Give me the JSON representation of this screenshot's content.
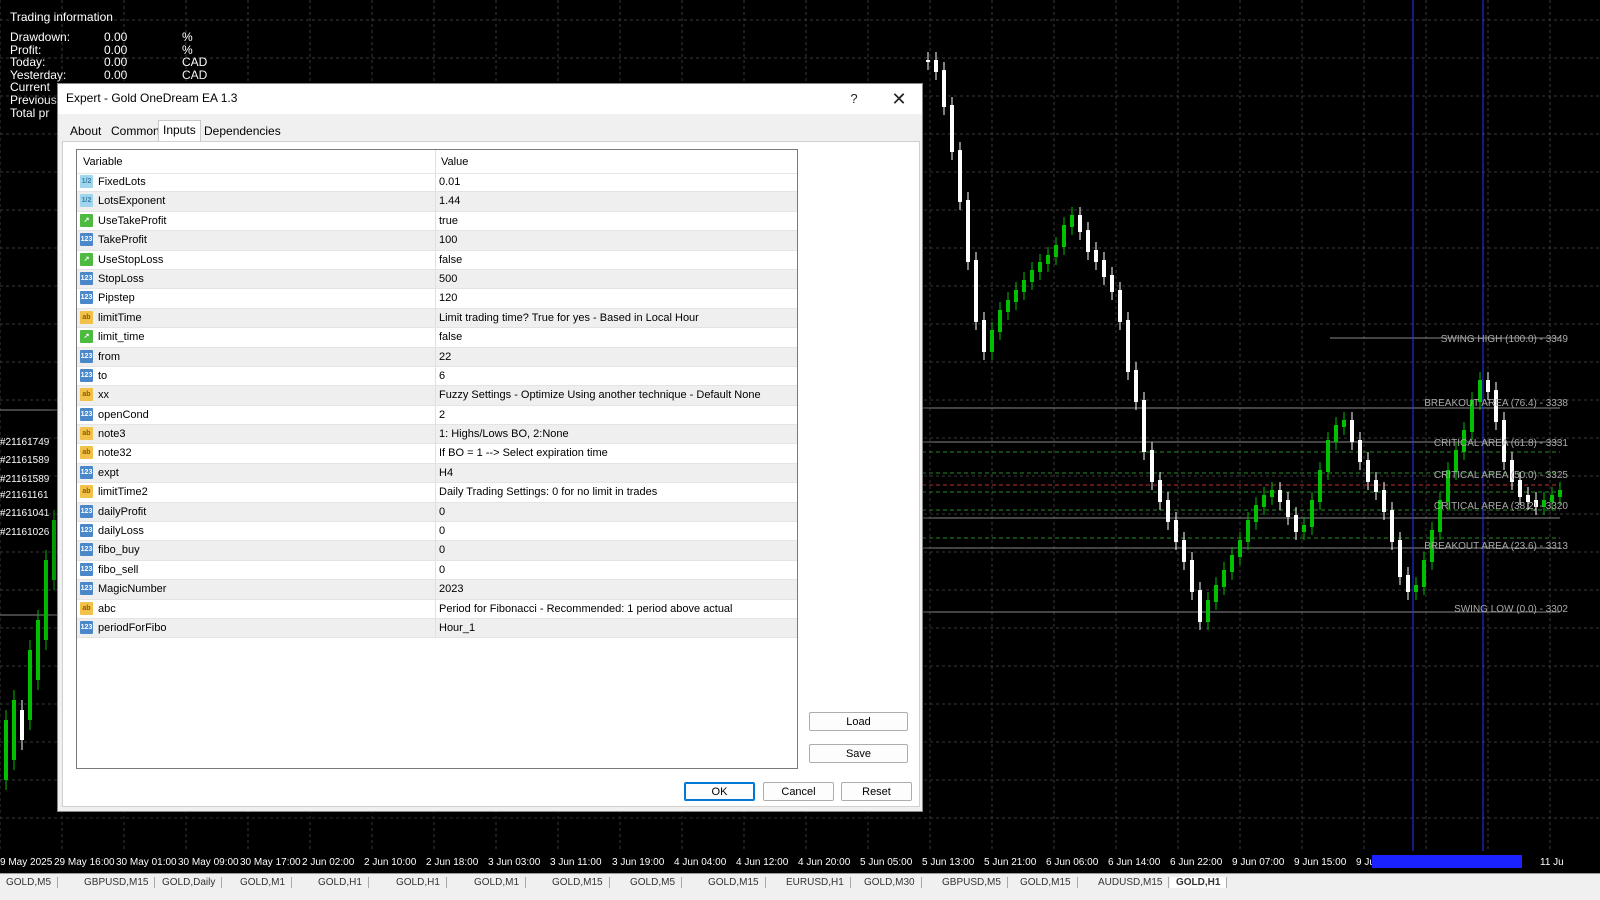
{
  "trading_info": {
    "title": "Trading information",
    "rows": [
      {
        "label": "Drawdown:",
        "value": "0.00",
        "unit": "%"
      },
      {
        "label": "Profit:",
        "value": "0.00",
        "unit": "%"
      },
      {
        "label": "Today:",
        "value": "0.00",
        "unit": "CAD"
      },
      {
        "label": "Yesterday:",
        "value": "0.00",
        "unit": "CAD"
      }
    ],
    "partial_rows": [
      "Current",
      "Previous",
      "Total pr"
    ]
  },
  "order_labels": [
    "#21161749",
    "#21161589",
    "#21161589",
    "#21161161",
    "#21161041",
    "#21161026"
  ],
  "fibo_levels": [
    {
      "label": "SWING HIGH (100.0) - 3349"
    },
    {
      "label": "BREAKOUT AREA (76.4) - 3338"
    },
    {
      "label": "CRITICAL AREA (61.8) - 3331"
    },
    {
      "label": "CRITICAL AREA (50.0) - 3325"
    },
    {
      "label": "CRITICAL AREA (38.2) - 3320"
    },
    {
      "label": "BREAKOUT AREA (23.6) - 3313"
    },
    {
      "label": "SWING LOW (0.0) - 3302"
    }
  ],
  "time_axis": [
    "9 May 2025",
    "29 May 16:00",
    "30 May 01:00",
    "30 May 09:00",
    "30 May 17:00",
    "2 Jun 02:00",
    "2 Jun 10:00",
    "2 Jun 18:00",
    "3 Jun 03:00",
    "3 Jun 11:00",
    "3 Jun 19:00",
    "4 Jun 04:00",
    "4 Jun 12:00",
    "4 Jun 20:00",
    "5 Jun 05:00",
    "5 Jun 13:00",
    "5 Jun 21:00",
    "6 Jun 06:00",
    "6 Jun 14:00",
    "6 Jun 22:00",
    "9 Jun 07:00",
    "9 Jun 15:00",
    "9 Ju",
    "11 Ju"
  ],
  "chart_tabs": [
    "GOLD,M5",
    "GBPUSD,M15",
    "GOLD,Daily",
    "GOLD,M1",
    "GOLD,H1",
    "GOLD,H1",
    "GOLD,M1",
    "GOLD,M15",
    "GOLD,M5",
    "GOLD,M15",
    "EURUSD,H1",
    "GOLD,M30",
    "GBPUSD,M5",
    "GOLD,M15",
    "AUDUSD,M15",
    "GOLD,H1"
  ],
  "dialog": {
    "title": "Expert - Gold OneDream EA 1.3",
    "help": "?",
    "close": "✕",
    "tabs": [
      "About",
      "Common",
      "Inputs",
      "Dependencies"
    ],
    "active_tab": "Inputs",
    "columns": {
      "variable": "Variable",
      "value": "Value"
    },
    "inputs": [
      {
        "type": "double",
        "icon": "1/2",
        "name": "FixedLots",
        "value": "0.01"
      },
      {
        "type": "double",
        "icon": "1/2",
        "name": "LotsExponent",
        "value": "1.44"
      },
      {
        "type": "bool",
        "icon": "↗",
        "name": "UseTakeProfit",
        "value": "true"
      },
      {
        "type": "int",
        "icon": "123",
        "name": "TakeProfit",
        "value": "100"
      },
      {
        "type": "bool",
        "icon": "↗",
        "name": "UseStopLoss",
        "value": "false"
      },
      {
        "type": "int",
        "icon": "123",
        "name": "StopLoss",
        "value": "500"
      },
      {
        "type": "int",
        "icon": "123",
        "name": "Pipstep",
        "value": "120"
      },
      {
        "type": "string",
        "icon": "ab",
        "name": "limitTime",
        "value": "Limit trading time? True for yes - Based in Local Hour"
      },
      {
        "type": "bool",
        "icon": "↗",
        "name": "limit_time",
        "value": "false"
      },
      {
        "type": "int",
        "icon": "123",
        "name": "from",
        "value": "22"
      },
      {
        "type": "int",
        "icon": "123",
        "name": "to",
        "value": "6"
      },
      {
        "type": "string",
        "icon": "ab",
        "name": "xx",
        "value": "Fuzzy Settings - Optimize Using another technique - Default None"
      },
      {
        "type": "int",
        "icon": "123",
        "name": "openCond",
        "value": "2"
      },
      {
        "type": "string",
        "icon": "ab",
        "name": "note3",
        "value": "1: Highs/Lows BO, 2:None"
      },
      {
        "type": "string",
        "icon": "ab",
        "name": "note32",
        "value": "If BO = 1 --> Select expiration time"
      },
      {
        "type": "int",
        "icon": "123",
        "name": "expt",
        "value": "H4"
      },
      {
        "type": "string",
        "icon": "ab",
        "name": "limitTime2",
        "value": "Daily Trading Settings: 0 for no limit in trades"
      },
      {
        "type": "int",
        "icon": "123",
        "name": "dailyProfit",
        "value": "0"
      },
      {
        "type": "int",
        "icon": "123",
        "name": "dailyLoss",
        "value": "0"
      },
      {
        "type": "int",
        "icon": "123",
        "name": "fibo_buy",
        "value": "0"
      },
      {
        "type": "int",
        "icon": "123",
        "name": "fibo_sell",
        "value": "0"
      },
      {
        "type": "int",
        "icon": "123",
        "name": "MagicNumber",
        "value": "2023"
      },
      {
        "type": "string",
        "icon": "ab",
        "name": "abc",
        "value": "Period for Fibonacci - Recommended: 1 period above actual"
      },
      {
        "type": "int",
        "icon": "123",
        "name": "periodForFibo",
        "value": "Hour_1"
      }
    ],
    "buttons": {
      "load": "Load",
      "save": "Save",
      "ok": "OK",
      "cancel": "Cancel",
      "reset": "Reset"
    }
  },
  "colors": {
    "bull": "#00c000",
    "bear": "#ffffff",
    "grid": "#3a3a3a",
    "dialog_bg": "#f0f0f0",
    "accent": "#0078d7"
  }
}
